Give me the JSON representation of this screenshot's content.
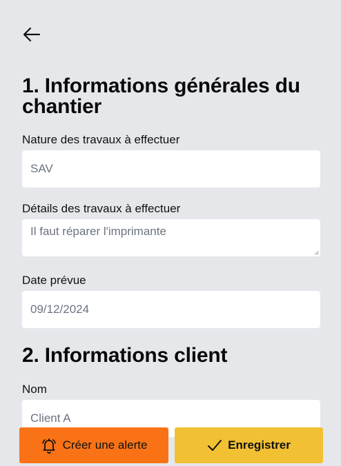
{
  "header": {
    "back_icon": "arrow-left-icon"
  },
  "section1": {
    "title": "1. Informations générales du chantier",
    "nature": {
      "label": "Nature des travaux à effectuer",
      "value": "SAV"
    },
    "details": {
      "label": "Détails des travaux à effectuer",
      "value": "Il faut réparer l'imprimante"
    },
    "date": {
      "label": "Date prévue",
      "value": "09/12/2024"
    }
  },
  "section2": {
    "title": "2. Informations client",
    "nom": {
      "label": "Nom",
      "value": "Client A"
    }
  },
  "actions": {
    "alert_label": "Créer une alerte",
    "alert_icon": "bell-icon",
    "save_label": "Enregistrer",
    "save_icon": "check-icon"
  },
  "colors": {
    "background": "#e5e7eb",
    "alert_button": "#f97316",
    "save_button": "#f2c033",
    "field_bg": "#ffffff",
    "value_text": "#6b7280"
  }
}
